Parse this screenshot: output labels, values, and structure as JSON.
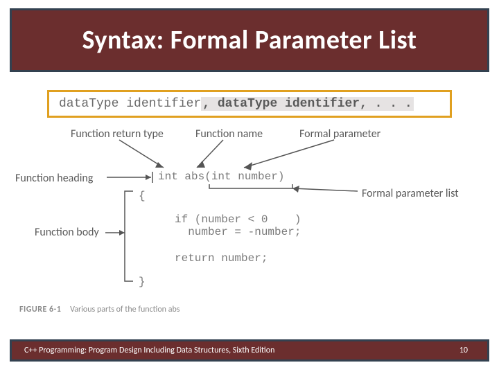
{
  "title": "Syntax: Formal Parameter List",
  "syntax": {
    "base": "dataType identifier",
    "optional": ", dataType identifier, . . ."
  },
  "labels": {
    "return_type": "Function return type",
    "func_name": "Function name",
    "formal_param": "Formal parameter",
    "heading": "Function heading",
    "param_list": "Formal parameter list",
    "body": "Function body"
  },
  "code": {
    "heading_line": "int abs(int number)",
    "open_brace": "{",
    "if_line": "if (number < 0    )",
    "assign_line": "  number = -number;",
    "return_line": "return number;",
    "close_brace": "}"
  },
  "figure": {
    "number": "FIGURE 6-1",
    "caption": "Various parts of the function abs"
  },
  "footer": {
    "text": "C++ Programming: Program Design Including Data Structures, Sixth Edition",
    "page": "10"
  }
}
